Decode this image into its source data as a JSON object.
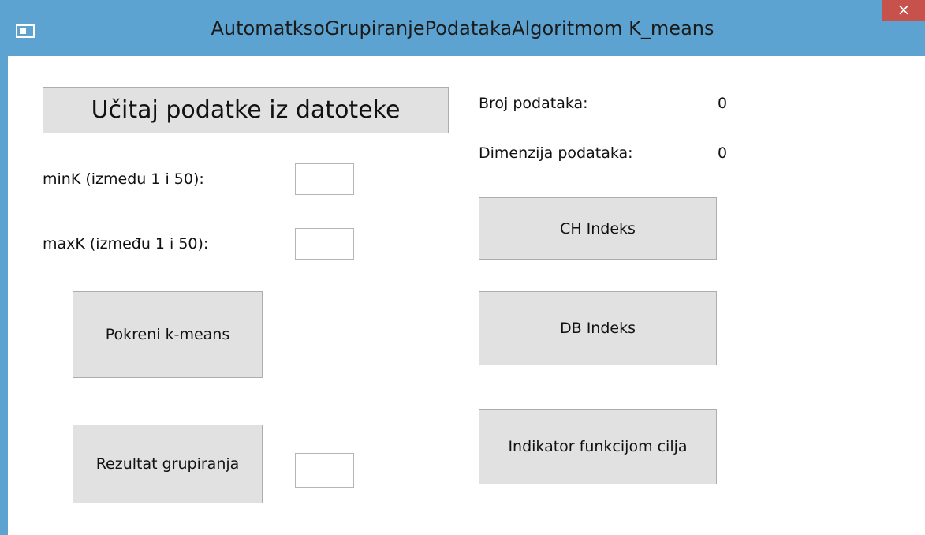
{
  "window": {
    "title": "AutomatksoGrupiranjePodatakaAlgoritmom K_means",
    "close_glyph": "×",
    "icon": "window-app-icon"
  },
  "left_panel": {
    "load_button": "Učitaj podatke iz datoteke",
    "min_k_label": "minK (između 1 i 50):",
    "min_k_value": "",
    "max_k_label": "maxK (između 1 i 50):",
    "max_k_value": "",
    "run_button": "Pokreni k-means",
    "result_button": "Rezultat grupiranja",
    "result_value": ""
  },
  "right_panel": {
    "data_count_label": "Broj podataka:",
    "data_count_value": "0",
    "data_dim_label": "Dimenzija podataka:",
    "data_dim_value": "0",
    "ch_button": "CH Indeks",
    "db_button": "DB Indeks",
    "objective_button": "Indikator funkcijom cilja"
  },
  "colors": {
    "titlebar": "#5da3d1",
    "close": "#c7514b",
    "button_face": "#e1e1e1"
  }
}
